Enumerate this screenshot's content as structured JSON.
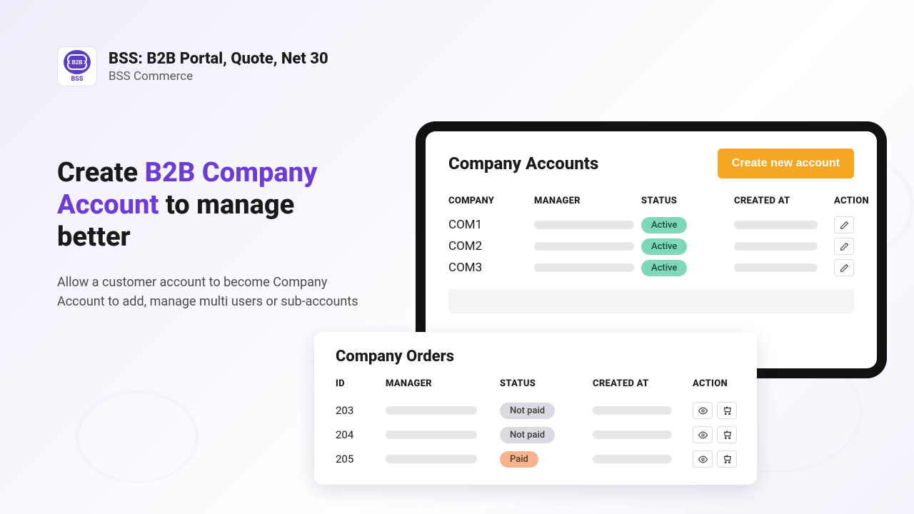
{
  "header": {
    "title": "BSS: B2B Portal, Quote, Net 30",
    "subtitle": "BSS Commerce",
    "logo_text": "B2B",
    "logo_badge": "BSS"
  },
  "hero": {
    "prefix": "Create ",
    "accent": "B2B Company Account",
    "suffix": " to manage better",
    "description": "Allow a customer account to become Company Account to add, manage multi users or sub-accounts"
  },
  "accounts_panel": {
    "title": "Company Accounts",
    "create_button": "Create new account",
    "columns": {
      "company": "COMPANY",
      "manager": "MANAGER",
      "status": "STATUS",
      "created_at": "CREATED AT",
      "action": "ACTION"
    },
    "rows": [
      {
        "company": "COM1",
        "status": "Active"
      },
      {
        "company": "COM2",
        "status": "Active"
      },
      {
        "company": "COM3",
        "status": "Active"
      }
    ]
  },
  "orders_panel": {
    "title": "Company Orders",
    "columns": {
      "id": "ID",
      "manager": "MANAGER",
      "status": "STATUS",
      "created_at": "CREATED AT",
      "action": "ACTION"
    },
    "rows": [
      {
        "id": "203",
        "status": "Not paid",
        "status_kind": "notpaid"
      },
      {
        "id": "204",
        "status": "Not paid",
        "status_kind": "notpaid"
      },
      {
        "id": "205",
        "status": "Paid",
        "status_kind": "paid"
      }
    ]
  },
  "colors": {
    "accent_purple": "#6b3cd6",
    "button_orange": "#f5a623",
    "badge_active": "#7fd8ba",
    "badge_notpaid": "#d9dbe0",
    "badge_paid": "#f5b48c"
  }
}
